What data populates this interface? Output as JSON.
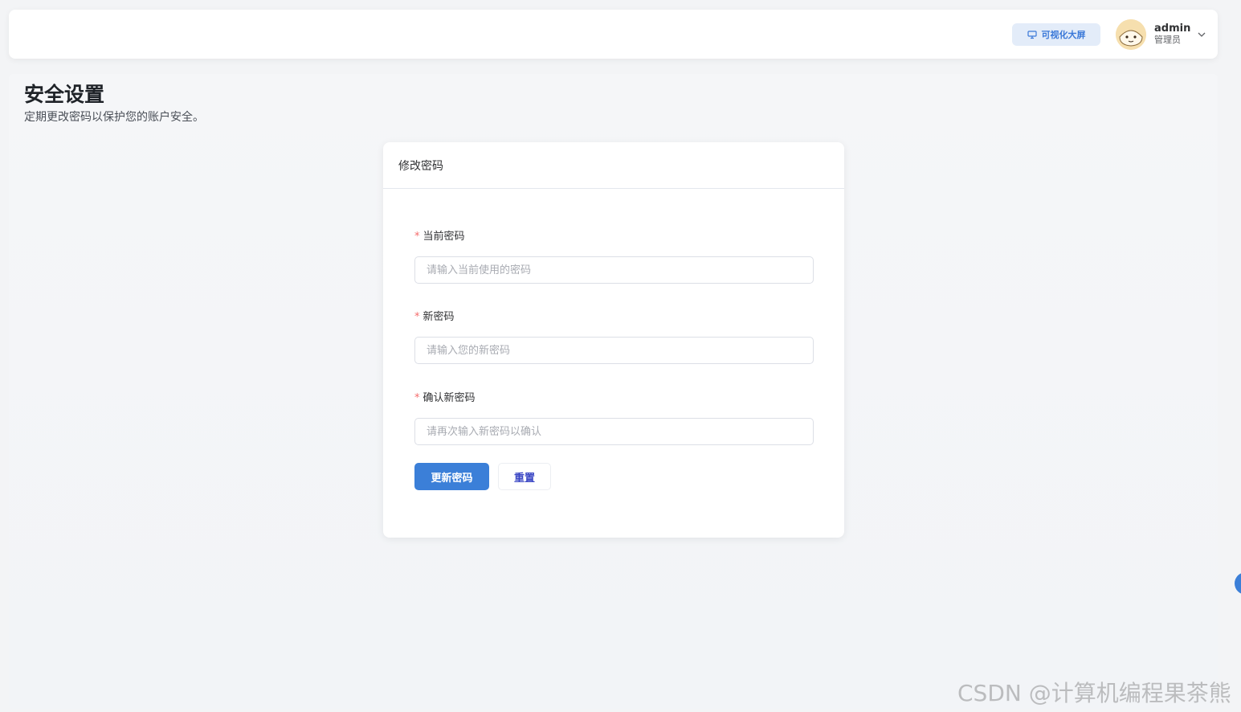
{
  "header": {
    "dashboard_label": "可视化大屏",
    "user_name": "admin",
    "user_role": "管理员"
  },
  "page": {
    "title": "安全设置",
    "subtitle": "定期更改密码以保护您的账户安全。"
  },
  "card": {
    "title": "修改密码",
    "required_mark": "*",
    "fields": [
      {
        "label": "当前密码",
        "placeholder": "请输入当前使用的密码",
        "value": ""
      },
      {
        "label": "新密码",
        "placeholder": "请输入您的新密码",
        "value": ""
      },
      {
        "label": "确认新密码",
        "placeholder": "请再次输入新密码以确认",
        "value": ""
      }
    ],
    "submit_label": "更新密码",
    "reset_label": "重置"
  },
  "watermark": "CSDN @计算机编程果茶熊",
  "colors": {
    "primary": "#3b7fd8",
    "required": "#f56c6c",
    "reset_text": "#3a46c4"
  }
}
